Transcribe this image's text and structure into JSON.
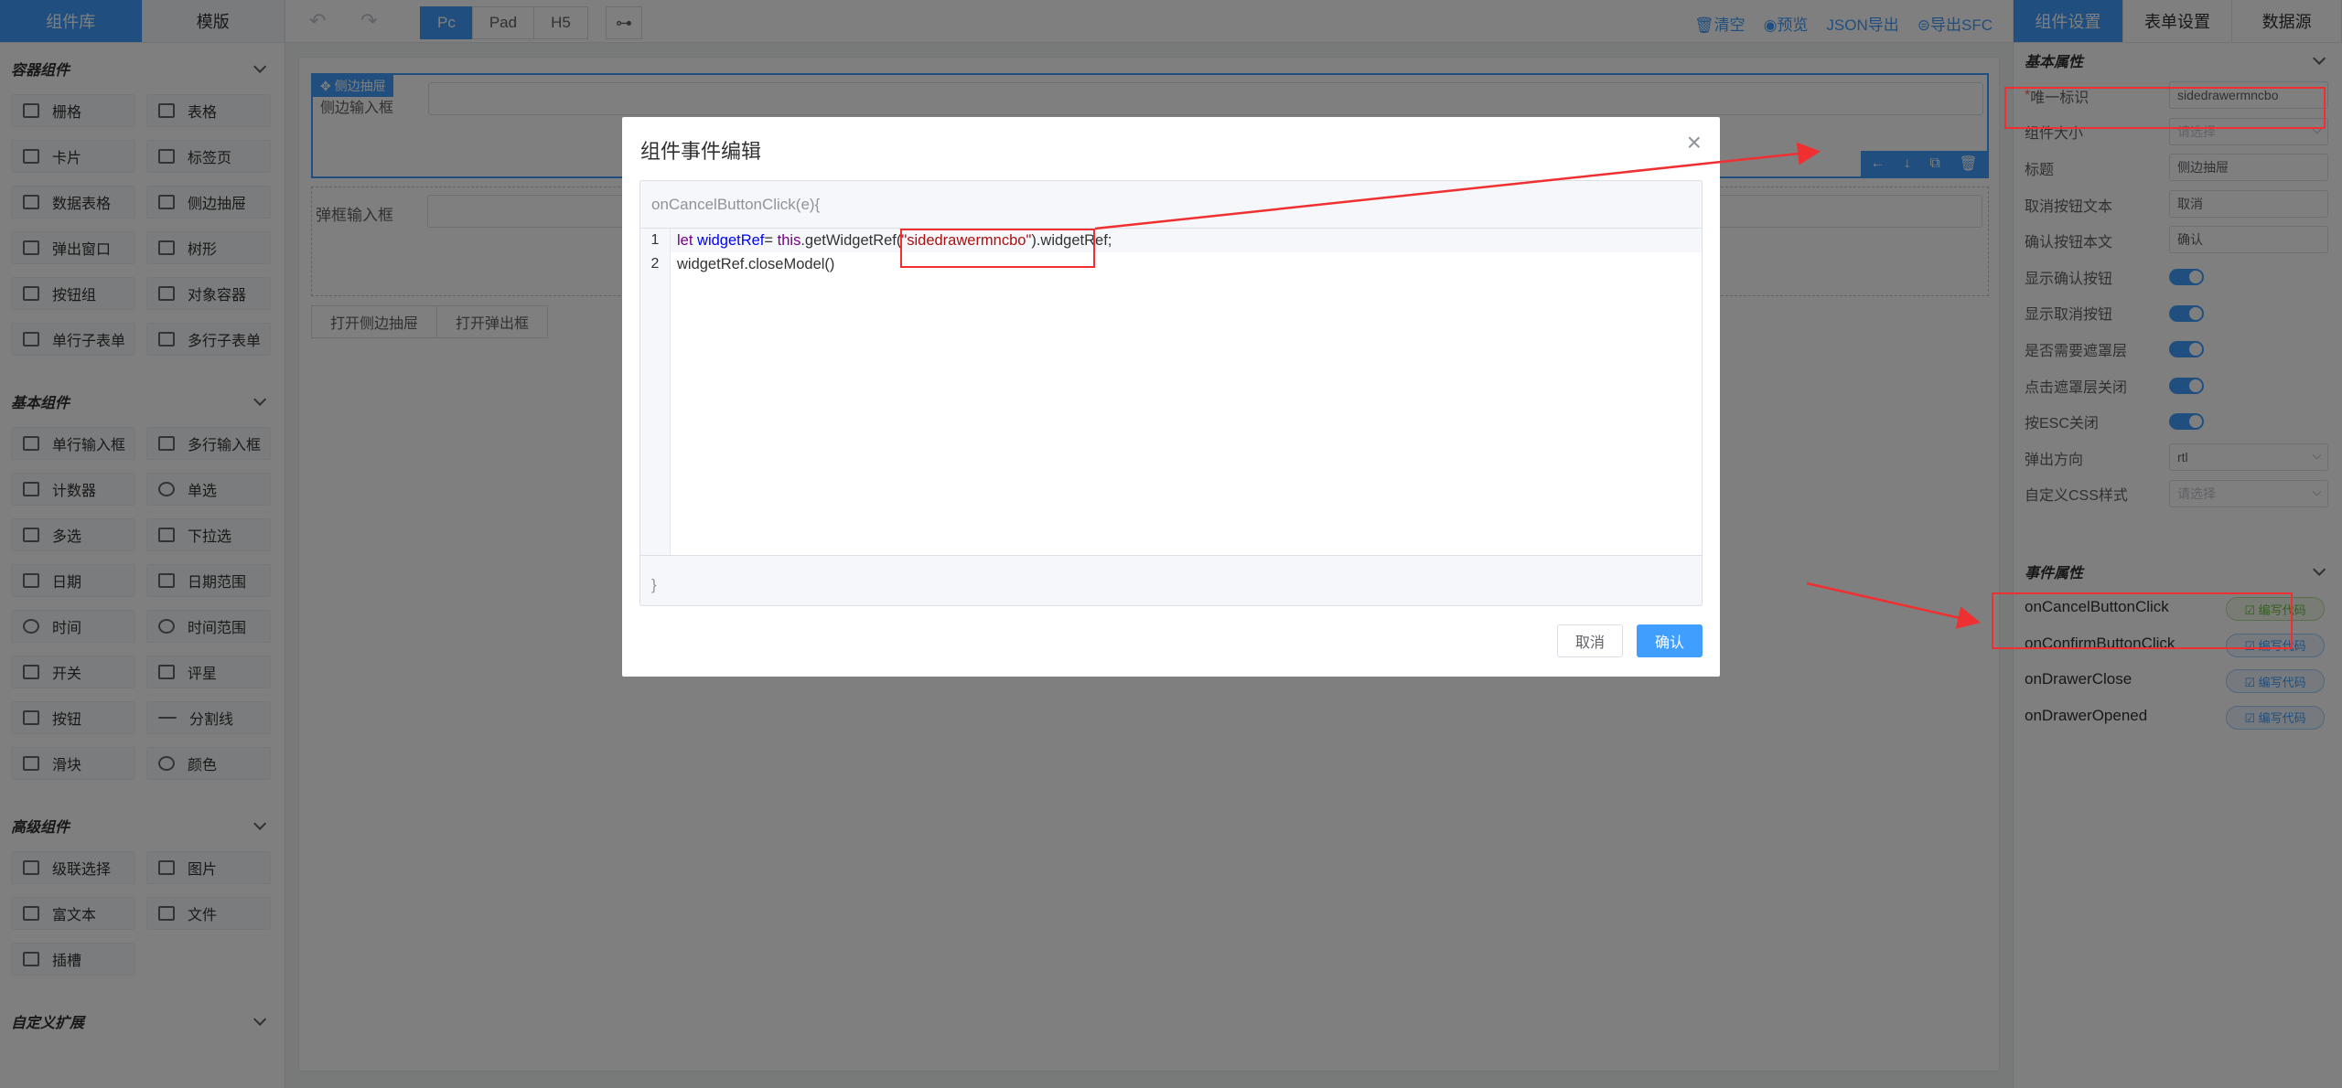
{
  "left_panel": {
    "tabs": [
      {
        "label": "组件库"
      },
      {
        "label": "模版"
      }
    ],
    "sections": [
      {
        "title": "容器组件",
        "items": [
          {
            "label": "栅格",
            "icon": "grid-icon"
          },
          {
            "label": "表格",
            "icon": "table-icon"
          },
          {
            "label": "卡片",
            "icon": "card-icon"
          },
          {
            "label": "标签页",
            "icon": "tabs-icon"
          },
          {
            "label": "数据表格",
            "icon": "data-table-icon"
          },
          {
            "label": "侧边抽屉",
            "icon": "drawer-icon"
          },
          {
            "label": "弹出窗口",
            "icon": "popup-icon"
          },
          {
            "label": "树形",
            "icon": "tree-icon"
          },
          {
            "label": "按钮组",
            "icon": "button-group-icon"
          },
          {
            "label": "对象容器",
            "icon": "object-container-icon"
          },
          {
            "label": "单行子表单",
            "icon": "single-row-subform-icon"
          },
          {
            "label": "多行子表单",
            "icon": "multi-row-subform-icon"
          }
        ]
      },
      {
        "title": "基本组件",
        "items": [
          {
            "label": "单行输入框",
            "icon": "input-icon"
          },
          {
            "label": "多行输入框",
            "icon": "textarea-icon"
          },
          {
            "label": "计数器",
            "icon": "counter-icon"
          },
          {
            "label": "单选",
            "icon": "radio-icon"
          },
          {
            "label": "多选",
            "icon": "checkbox-icon"
          },
          {
            "label": "下拉选",
            "icon": "select-icon"
          },
          {
            "label": "日期",
            "icon": "date-icon"
          },
          {
            "label": "日期范围",
            "icon": "date-range-icon"
          },
          {
            "label": "时间",
            "icon": "time-icon"
          },
          {
            "label": "时间范围",
            "icon": "time-range-icon"
          },
          {
            "label": "开关",
            "icon": "switch-icon"
          },
          {
            "label": "评星",
            "icon": "star-icon"
          },
          {
            "label": "按钮",
            "icon": "button-icon"
          },
          {
            "label": "分割线",
            "icon": "divider-icon"
          },
          {
            "label": "滑块",
            "icon": "slider-icon"
          },
          {
            "label": "颜色",
            "icon": "color-icon"
          }
        ]
      },
      {
        "title": "高级组件",
        "items": [
          {
            "label": "级联选择",
            "icon": "cascader-icon"
          },
          {
            "label": "图片",
            "icon": "image-icon"
          },
          {
            "label": "富文本",
            "icon": "rich-text-icon"
          },
          {
            "label": "文件",
            "icon": "file-icon"
          },
          {
            "label": "插槽",
            "icon": "slot-icon"
          }
        ]
      },
      {
        "title": "自定义扩展",
        "items": []
      }
    ]
  },
  "toolbar": {
    "undo": "↶",
    "redo": "↷",
    "devices": [
      {
        "label": "Pc",
        "active": true
      },
      {
        "label": "Pad"
      },
      {
        "label": "H5"
      }
    ],
    "tree": "⊶",
    "links": [
      {
        "label": "清空"
      },
      {
        "label": "预览"
      },
      {
        "label": "JSON导出"
      },
      {
        "label": "导出SFC"
      }
    ]
  },
  "canvas": {
    "drawer_tag": "✥ 侧边抽屉",
    "drawer_ghost_label": "侧边输入框",
    "tools": [
      "←",
      "↓",
      "⧉",
      "🗑"
    ],
    "popup_input_label": "弹框输入框",
    "buttons": [
      {
        "label": "打开侧边抽屉"
      },
      {
        "label": "打开弹出框"
      }
    ]
  },
  "right_panel": {
    "tabs": [
      {
        "label": "组件设置"
      },
      {
        "label": "表单设置"
      },
      {
        "label": "数据源"
      }
    ],
    "basic_title": "基本属性",
    "props": [
      {
        "label": "唯一标识",
        "value": "sidedrawermncbo",
        "required": "* "
      },
      {
        "label": "组件大小",
        "placeholder": "请选择"
      },
      {
        "label": "标题",
        "value": "侧边抽屉"
      },
      {
        "label": "取消按钮文本",
        "value": "取消"
      },
      {
        "label": "确认按钮本文",
        "value": "确认"
      },
      {
        "label": "显示确认按钮"
      },
      {
        "label": "显示取消按钮"
      },
      {
        "label": "是否需要遮罩层"
      },
      {
        "label": "点击遮罩层关闭"
      },
      {
        "label": "按ESC关闭"
      },
      {
        "label": "弹出方向",
        "value": "rtl"
      },
      {
        "label": "自定义CSS样式",
        "placeholder": "请选择"
      }
    ],
    "event_title": "事件属性",
    "events": [
      {
        "label": "onCancelButtonClick",
        "btn": "☑ 编写代码"
      },
      {
        "label": "onConfirmButtonClick",
        "btn": "☑ 编写代码"
      },
      {
        "label": "onDrawerClose",
        "btn": "☑ 编写代码"
      },
      {
        "label": "onDrawerOpened",
        "btn": "☑ 编写代码"
      }
    ]
  },
  "dialog": {
    "title": "组件事件编辑",
    "close": "×",
    "signature": "onCancelButtonClick(e){",
    "line_numbers": [
      "1",
      "2"
    ],
    "code_line1": {
      "kw1": "let",
      "var1": " widgetRef",
      "op": "= ",
      "kw2": "this",
      "call": ".getWidgetRef(",
      "str": "\"sidedrawermncbo\"",
      "tail": ").widgetRef;"
    },
    "code_line2": "widgetRef.closeModel()",
    "footer": "}",
    "cancel": "取消",
    "confirm": "确认"
  },
  "colors": {
    "accent": "#409eff",
    "annotation": "#f03030",
    "keyword": "#770088",
    "variable": "#0000ff",
    "string": "#aa1111"
  }
}
